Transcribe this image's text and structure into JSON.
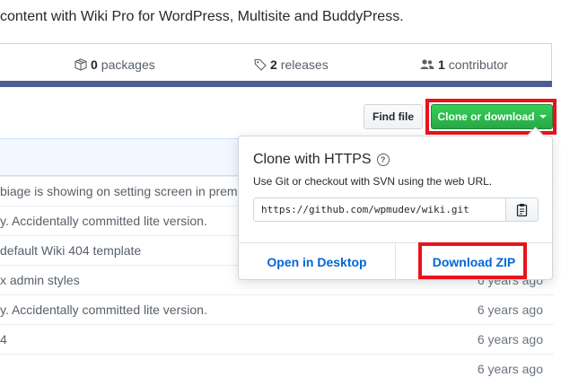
{
  "repo": {
    "description": "content with Wiki Pro for WordPress, Multisite and BuddyPress."
  },
  "summary": {
    "packages_count": "0",
    "packages_label": "packages",
    "releases_count": "2",
    "releases_label": "releases",
    "contributors_count": "1",
    "contributors_label": "contributor",
    "language_color": "#4f5d95"
  },
  "toolbar": {
    "find_file_label": "Find file",
    "clone_label": "Clone or download"
  },
  "clone_popover": {
    "title": "Clone with HTTPS",
    "help_icon": "question-icon",
    "description": "Use Git or checkout with SVN using the web URL.",
    "url": "https://github.com/wpmudev/wiki.git",
    "copy_icon": "clipboard-icon",
    "open_desktop_label": "Open in Desktop",
    "download_zip_label": "Download ZIP"
  },
  "files": [
    {
      "message": "biage is showing on setting screen in premi",
      "age": ""
    },
    {
      "message": "y. Accidentally committed lite version.",
      "age": ""
    },
    {
      "message": " default Wiki 404 template",
      "age": ""
    },
    {
      "message": "x admin styles",
      "age": "6 years ago"
    },
    {
      "message": "y. Accidentally committed lite version.",
      "age": "6 years ago"
    },
    {
      "message": "4",
      "age": "6 years ago"
    },
    {
      "message": "",
      "age": "6 years ago"
    }
  ],
  "colors": {
    "primary_button": "#28a745",
    "highlight_box": "#e8141b",
    "link": "#0366d6"
  }
}
